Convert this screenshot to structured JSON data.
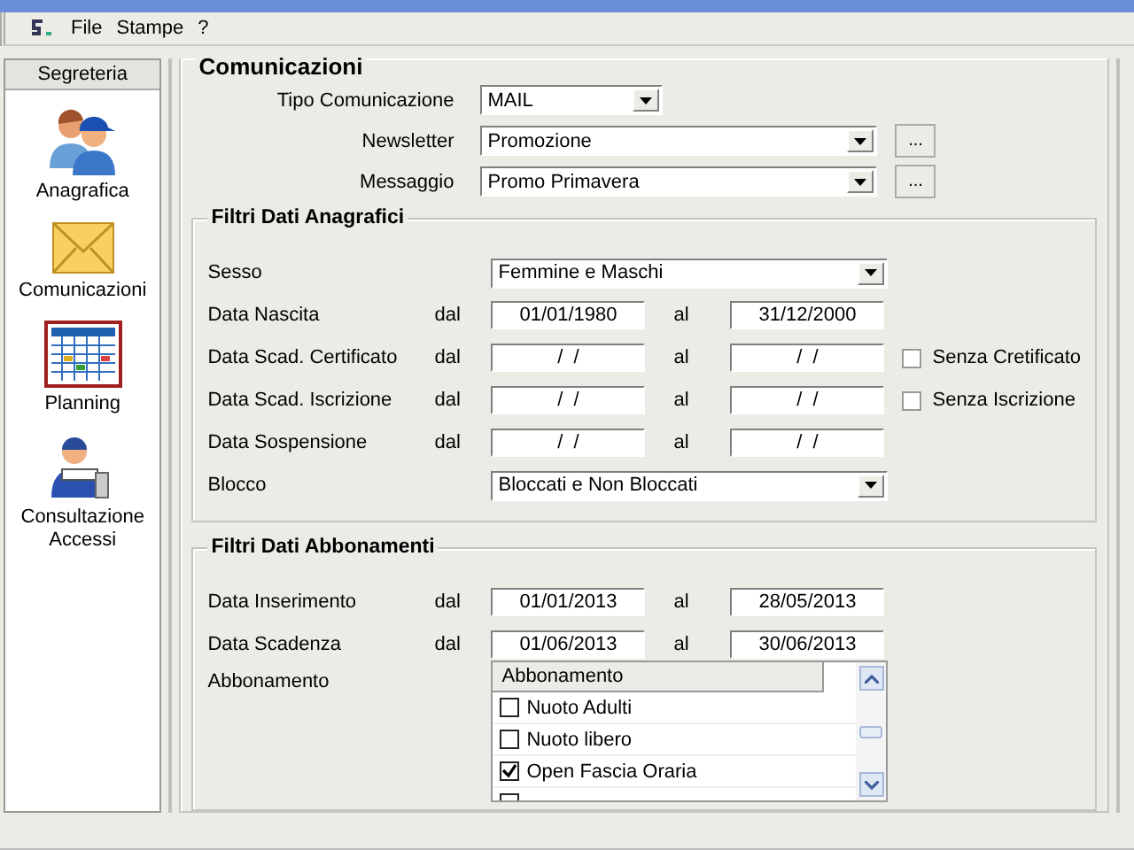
{
  "menu": [
    "File",
    "Stampe",
    "?"
  ],
  "sidebar": {
    "title": "Segreteria",
    "items": [
      {
        "label": "Anagrafica"
      },
      {
        "label": "Comunicazioni"
      },
      {
        "label": "Planning"
      },
      {
        "label": "Consultazione Accessi"
      }
    ]
  },
  "communications": {
    "title": "Comunicazioni",
    "fields": [
      {
        "label": "Tipo Comunicazione",
        "value": "MAIL",
        "kind": "short"
      },
      {
        "label": "Newsletter",
        "value": "Promozione",
        "kind": "with_button",
        "button": "..."
      },
      {
        "label": "Messaggio",
        "value": "Promo Primavera",
        "kind": "with_button",
        "button": "..."
      }
    ]
  },
  "anagrafici": {
    "title": "Filtri Dati Anagrafici",
    "rows": [
      {
        "kind": "combo",
        "label": "Sesso",
        "value": "Femmine e Maschi"
      },
      {
        "kind": "range",
        "label": "Data Nascita",
        "from_label": "dal",
        "from": "01/01/1980",
        "to_label": "al",
        "to": "31/12/2000"
      },
      {
        "kind": "range",
        "label": "Data Scad. Certificato",
        "from_label": "dal",
        "from": "/  /",
        "to_label": "al",
        "to": "/  /",
        "checkbox": {
          "label": "Senza Cretificato",
          "checked": false
        }
      },
      {
        "kind": "range",
        "label": "Data Scad. Iscrizione",
        "from_label": "dal",
        "from": "/  /",
        "to_label": "al",
        "to": "/  /",
        "checkbox": {
          "label": "Senza Iscrizione",
          "checked": false
        }
      },
      {
        "kind": "range",
        "label": "Data Sospensione",
        "from_label": "dal",
        "from": "/  /",
        "to_label": "al",
        "to": "/  /"
      },
      {
        "kind": "combo",
        "label": "Blocco",
        "value": "Bloccati e Non Bloccati"
      }
    ]
  },
  "abbonamenti": {
    "title": "Filtri Dati Abbonamenti",
    "rows": [
      {
        "kind": "range",
        "label": "Data Inserimento",
        "from_label": "dal",
        "from": "01/01/2013",
        "to_label": "al",
        "to": "28/05/2013"
      },
      {
        "kind": "range",
        "label": "Data Scadenza",
        "from_label": "dal",
        "from": "01/06/2013",
        "to_label": "al",
        "to": "30/06/2013"
      }
    ],
    "list": {
      "label": "Abbonamento",
      "header": "Abbonamento",
      "items": [
        {
          "label": "Nuoto Adulti",
          "checked": false
        },
        {
          "label": "Nuoto libero",
          "checked": false
        },
        {
          "label": "Open Fascia Oraria",
          "checked": true
        }
      ]
    }
  }
}
